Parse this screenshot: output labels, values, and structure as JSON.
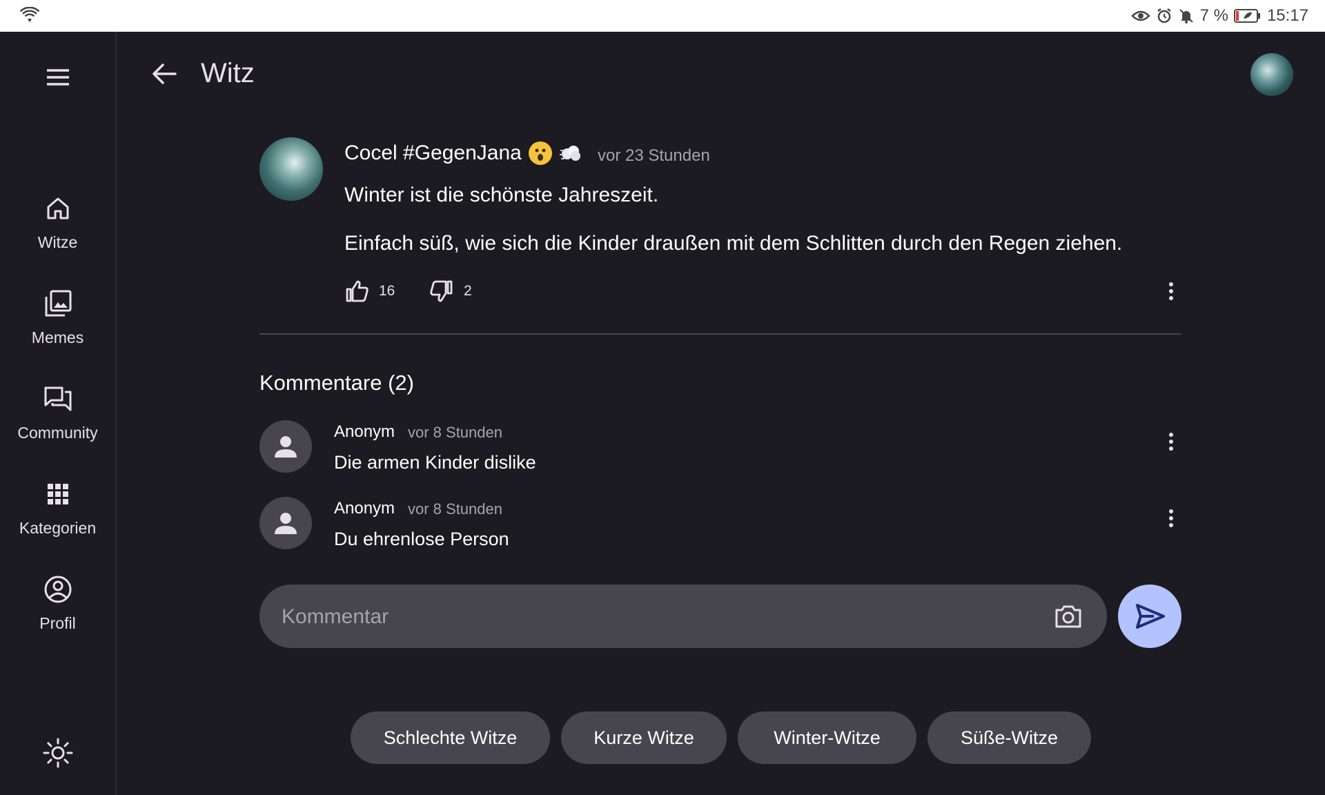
{
  "status_bar": {
    "battery": "7 %",
    "time": "15:17",
    "icons": [
      "wifi-icon",
      "eye-icon",
      "alarm-icon",
      "bell-off-icon",
      "battery-saver-icon"
    ]
  },
  "sidebar": {
    "items": [
      {
        "label": "Witze",
        "icon": "home-icon"
      },
      {
        "label": "Memes",
        "icon": "image-library-icon"
      },
      {
        "label": "Community",
        "icon": "forum-icon"
      },
      {
        "label": "Kategorien",
        "icon": "grid-icon"
      },
      {
        "label": "Profil",
        "icon": "account-circle-icon"
      }
    ]
  },
  "header": {
    "title": "Witz"
  },
  "post": {
    "author": "Cocel #GegenJana",
    "time": "vor 23 Stunden",
    "line1": "Winter ist die schönste Jahreszeit.",
    "line2": "Einfach süß, wie sich die Kinder draußen mit dem Schlitten durch den Regen ziehen.",
    "likes": "16",
    "dislikes": "2"
  },
  "comments": {
    "title": "Kommentare (2)",
    "items": [
      {
        "author": "Anonym",
        "time": "vor 8 Stunden",
        "text": "Die armen Kinder dislike"
      },
      {
        "author": "Anonym",
        "time": "vor 8 Stunden",
        "text": "Du ehrenlose Person"
      }
    ]
  },
  "input": {
    "placeholder": "Kommentar"
  },
  "chips": [
    "Schlechte Witze",
    "Kurze Witze",
    "Winter-Witze",
    "Süße-Witze"
  ],
  "colors": {
    "background": "#1c1b21",
    "surface": "#47464e",
    "send_button": "#b3c3ff",
    "send_icon": "#1b2d7a"
  }
}
